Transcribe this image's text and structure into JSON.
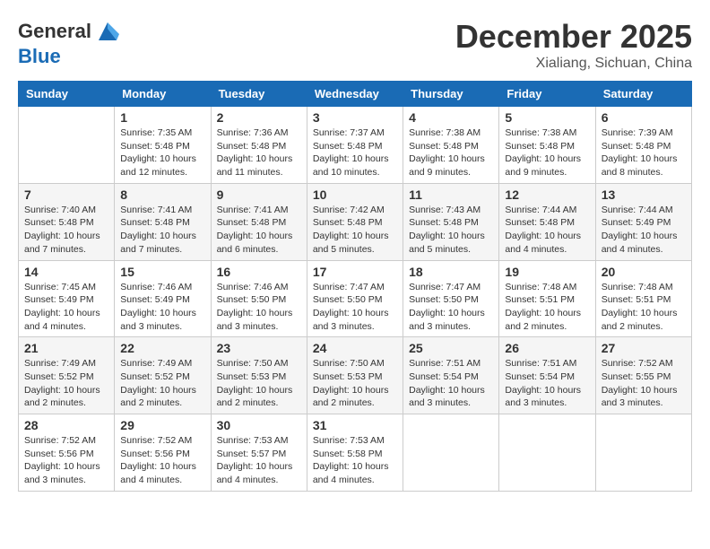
{
  "header": {
    "logo_general": "General",
    "logo_blue": "Blue",
    "month_title": "December 2025",
    "location": "Xialiang, Sichuan, China"
  },
  "columns": [
    "Sunday",
    "Monday",
    "Tuesday",
    "Wednesday",
    "Thursday",
    "Friday",
    "Saturday"
  ],
  "weeks": [
    [
      {
        "day": "",
        "info": ""
      },
      {
        "day": "1",
        "info": "Sunrise: 7:35 AM\nSunset: 5:48 PM\nDaylight: 10 hours\nand 12 minutes."
      },
      {
        "day": "2",
        "info": "Sunrise: 7:36 AM\nSunset: 5:48 PM\nDaylight: 10 hours\nand 11 minutes."
      },
      {
        "day": "3",
        "info": "Sunrise: 7:37 AM\nSunset: 5:48 PM\nDaylight: 10 hours\nand 10 minutes."
      },
      {
        "day": "4",
        "info": "Sunrise: 7:38 AM\nSunset: 5:48 PM\nDaylight: 10 hours\nand 9 minutes."
      },
      {
        "day": "5",
        "info": "Sunrise: 7:38 AM\nSunset: 5:48 PM\nDaylight: 10 hours\nand 9 minutes."
      },
      {
        "day": "6",
        "info": "Sunrise: 7:39 AM\nSunset: 5:48 PM\nDaylight: 10 hours\nand 8 minutes."
      }
    ],
    [
      {
        "day": "7",
        "info": "Sunrise: 7:40 AM\nSunset: 5:48 PM\nDaylight: 10 hours\nand 7 minutes."
      },
      {
        "day": "8",
        "info": "Sunrise: 7:41 AM\nSunset: 5:48 PM\nDaylight: 10 hours\nand 7 minutes."
      },
      {
        "day": "9",
        "info": "Sunrise: 7:41 AM\nSunset: 5:48 PM\nDaylight: 10 hours\nand 6 minutes."
      },
      {
        "day": "10",
        "info": "Sunrise: 7:42 AM\nSunset: 5:48 PM\nDaylight: 10 hours\nand 5 minutes."
      },
      {
        "day": "11",
        "info": "Sunrise: 7:43 AM\nSunset: 5:48 PM\nDaylight: 10 hours\nand 5 minutes."
      },
      {
        "day": "12",
        "info": "Sunrise: 7:44 AM\nSunset: 5:48 PM\nDaylight: 10 hours\nand 4 minutes."
      },
      {
        "day": "13",
        "info": "Sunrise: 7:44 AM\nSunset: 5:49 PM\nDaylight: 10 hours\nand 4 minutes."
      }
    ],
    [
      {
        "day": "14",
        "info": "Sunrise: 7:45 AM\nSunset: 5:49 PM\nDaylight: 10 hours\nand 4 minutes."
      },
      {
        "day": "15",
        "info": "Sunrise: 7:46 AM\nSunset: 5:49 PM\nDaylight: 10 hours\nand 3 minutes."
      },
      {
        "day": "16",
        "info": "Sunrise: 7:46 AM\nSunset: 5:50 PM\nDaylight: 10 hours\nand 3 minutes."
      },
      {
        "day": "17",
        "info": "Sunrise: 7:47 AM\nSunset: 5:50 PM\nDaylight: 10 hours\nand 3 minutes."
      },
      {
        "day": "18",
        "info": "Sunrise: 7:47 AM\nSunset: 5:50 PM\nDaylight: 10 hours\nand 3 minutes."
      },
      {
        "day": "19",
        "info": "Sunrise: 7:48 AM\nSunset: 5:51 PM\nDaylight: 10 hours\nand 2 minutes."
      },
      {
        "day": "20",
        "info": "Sunrise: 7:48 AM\nSunset: 5:51 PM\nDaylight: 10 hours\nand 2 minutes."
      }
    ],
    [
      {
        "day": "21",
        "info": "Sunrise: 7:49 AM\nSunset: 5:52 PM\nDaylight: 10 hours\nand 2 minutes."
      },
      {
        "day": "22",
        "info": "Sunrise: 7:49 AM\nSunset: 5:52 PM\nDaylight: 10 hours\nand 2 minutes."
      },
      {
        "day": "23",
        "info": "Sunrise: 7:50 AM\nSunset: 5:53 PM\nDaylight: 10 hours\nand 2 minutes."
      },
      {
        "day": "24",
        "info": "Sunrise: 7:50 AM\nSunset: 5:53 PM\nDaylight: 10 hours\nand 2 minutes."
      },
      {
        "day": "25",
        "info": "Sunrise: 7:51 AM\nSunset: 5:54 PM\nDaylight: 10 hours\nand 3 minutes."
      },
      {
        "day": "26",
        "info": "Sunrise: 7:51 AM\nSunset: 5:54 PM\nDaylight: 10 hours\nand 3 minutes."
      },
      {
        "day": "27",
        "info": "Sunrise: 7:52 AM\nSunset: 5:55 PM\nDaylight: 10 hours\nand 3 minutes."
      }
    ],
    [
      {
        "day": "28",
        "info": "Sunrise: 7:52 AM\nSunset: 5:56 PM\nDaylight: 10 hours\nand 3 minutes."
      },
      {
        "day": "29",
        "info": "Sunrise: 7:52 AM\nSunset: 5:56 PM\nDaylight: 10 hours\nand 4 minutes."
      },
      {
        "day": "30",
        "info": "Sunrise: 7:53 AM\nSunset: 5:57 PM\nDaylight: 10 hours\nand 4 minutes."
      },
      {
        "day": "31",
        "info": "Sunrise: 7:53 AM\nSunset: 5:58 PM\nDaylight: 10 hours\nand 4 minutes."
      },
      {
        "day": "",
        "info": ""
      },
      {
        "day": "",
        "info": ""
      },
      {
        "day": "",
        "info": ""
      }
    ]
  ]
}
